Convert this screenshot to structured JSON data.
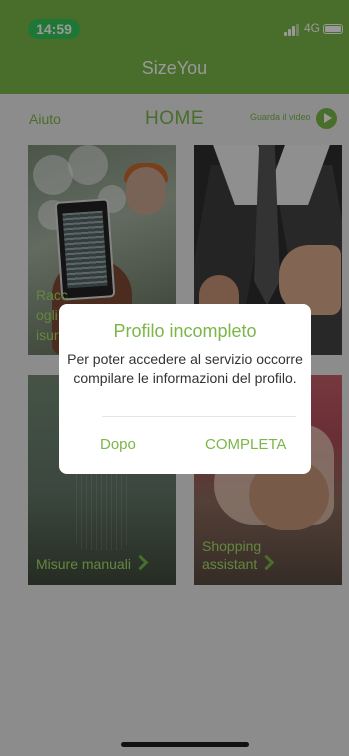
{
  "status_bar": {
    "time": "14:59",
    "network": "4G"
  },
  "nav": {
    "title": "SizeYou"
  },
  "header": {
    "help": "Aiuto",
    "title": "HOME",
    "video": "Guarda il video"
  },
  "tiles": [
    {
      "label": "Raccogli misure da foto",
      "visible_label": "Raccogli\nmis\nda"
    },
    {
      "label": ""
    },
    {
      "label": "Misure manuali"
    },
    {
      "label": "Shopping assistant"
    }
  ],
  "dialog": {
    "title": "Profilo incompleto",
    "message": "Per poter accedere al servizio occorre compilare le informazioni del profilo.",
    "later_button": "Dopo",
    "complete_button": "COMPLETA"
  },
  "colors": {
    "brand_green": "#7ab648",
    "label_green": "#a6e06a",
    "time_pill": "#34c759"
  }
}
